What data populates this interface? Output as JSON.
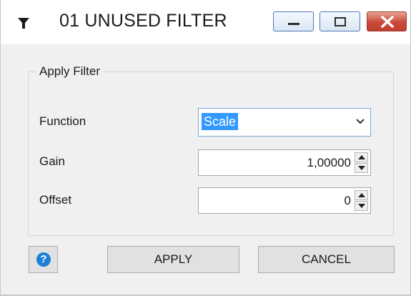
{
  "window": {
    "title": "01 UNUSED FILTER",
    "title_icon": "filter-icon",
    "caption_buttons": [
      "minimize-icon",
      "maximize-icon",
      "close-icon"
    ]
  },
  "group": {
    "title": "Apply Filter"
  },
  "fields": {
    "function": {
      "label": "Function",
      "value": "Scale"
    },
    "gain": {
      "label": "Gain",
      "value": "1,00000"
    },
    "offset": {
      "label": "Offset",
      "value": "0"
    }
  },
  "buttons": {
    "help_icon": "help-icon",
    "help_glyph": "?",
    "apply": "APPLY",
    "cancel": "CANCEL"
  },
  "colors": {
    "selection": "#3399ff",
    "help": "#1e7fd8",
    "close_button": "#c9483a"
  }
}
